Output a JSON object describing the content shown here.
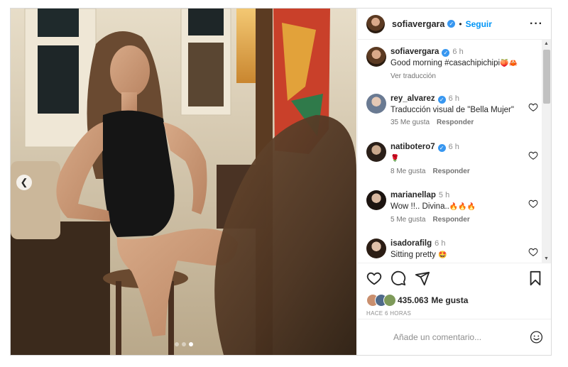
{
  "header": {
    "username": "sofiavergara",
    "separator": "•",
    "follow_label": "Seguir",
    "more_icon": "more-horizontal-icon"
  },
  "caption": {
    "username": "sofiavergara",
    "time": "6 h",
    "text": "Good morning #casachipichipi",
    "emoji": "🍑🦀",
    "translate_label": "Ver traducción"
  },
  "comments": [
    {
      "username": "rey_alvarez",
      "time": "6 h",
      "text": "Traducción visual de \"Bella Mujer\"",
      "emoji": "",
      "likes": "35 Me gusta",
      "reply": "Responder"
    },
    {
      "username": "natibotero7",
      "time": "6 h",
      "text": "",
      "emoji": "🌹",
      "likes": "8 Me gusta",
      "reply": "Responder"
    },
    {
      "username": "marianellap",
      "time": "5 h",
      "text": "Wow !!.. Divina..",
      "emoji": "🔥🔥🔥",
      "likes": "5 Me gusta",
      "reply": "Responder"
    },
    {
      "username": "isadorafilg",
      "time": "6 h",
      "text": "Sitting pretty",
      "emoji": "🤩",
      "likes": "",
      "reply": ""
    }
  ],
  "actions": {
    "icons": [
      "heart-icon",
      "comment-icon",
      "share-icon",
      "bookmark-icon"
    ]
  },
  "likes": {
    "count": "435.063",
    "label": "Me gusta"
  },
  "time_ago": "HACE 6 HORAS",
  "add_comment": {
    "placeholder": "Añade un comentario..."
  },
  "carousel": {
    "slides": 3,
    "active": 3
  },
  "colors": {
    "follow": "#0095f6",
    "verified": "#3897f0",
    "text": "#262626",
    "muted": "#8e8e8e"
  }
}
